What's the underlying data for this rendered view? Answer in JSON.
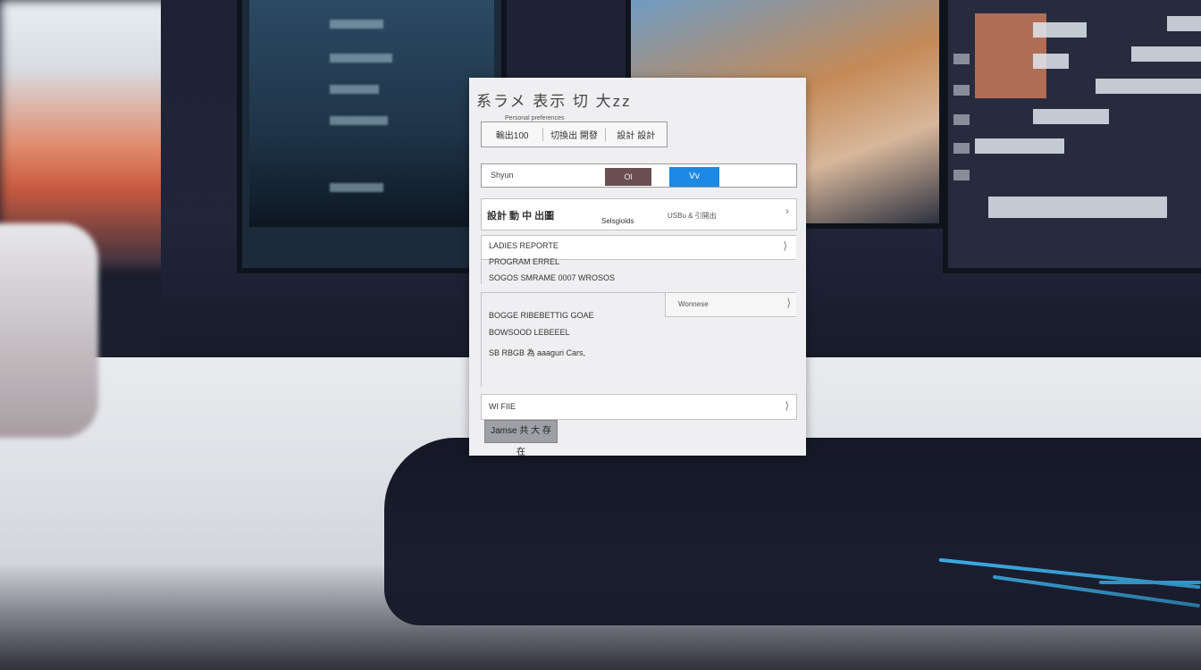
{
  "colors": {
    "accent_blue": "#1e88e5",
    "ok_button": "#6b4f52",
    "dialog_bg": "#efeff1"
  },
  "dialog": {
    "title": "系ラメ 表示 切 大zz",
    "caption": "Personal preferences",
    "segments": [
      "輸出100",
      "切換出 開發",
      "設計 設計"
    ],
    "toolbar": {
      "text": "Shyun",
      "ok_label": "Ol",
      "v_label": "Vv"
    },
    "row1": {
      "left": "設計 動 中 出圖",
      "middle": "Selsgiolds",
      "right": "USBu & 引開出",
      "chevron": "›"
    },
    "section2": {
      "line1": "LADIES REPORTE",
      "line2": "PROGRAM ERREL",
      "line3": "SOGOS SMRAME 0007 WROSOS",
      "chevron": "⟩"
    },
    "section3": {
      "dropdown": "Wonnese",
      "line1": "BOGGE RIBEBETTIG GOAE",
      "line2": "BOWSOOD LEBEEEL",
      "line3": "SB RBGB 為 aaaguri Cars,",
      "chevron": "⟩"
    },
    "row4": {
      "label": "WI FIIE",
      "chevron": "⟩"
    },
    "apply_label": "Jamse 共 大 存 在"
  }
}
